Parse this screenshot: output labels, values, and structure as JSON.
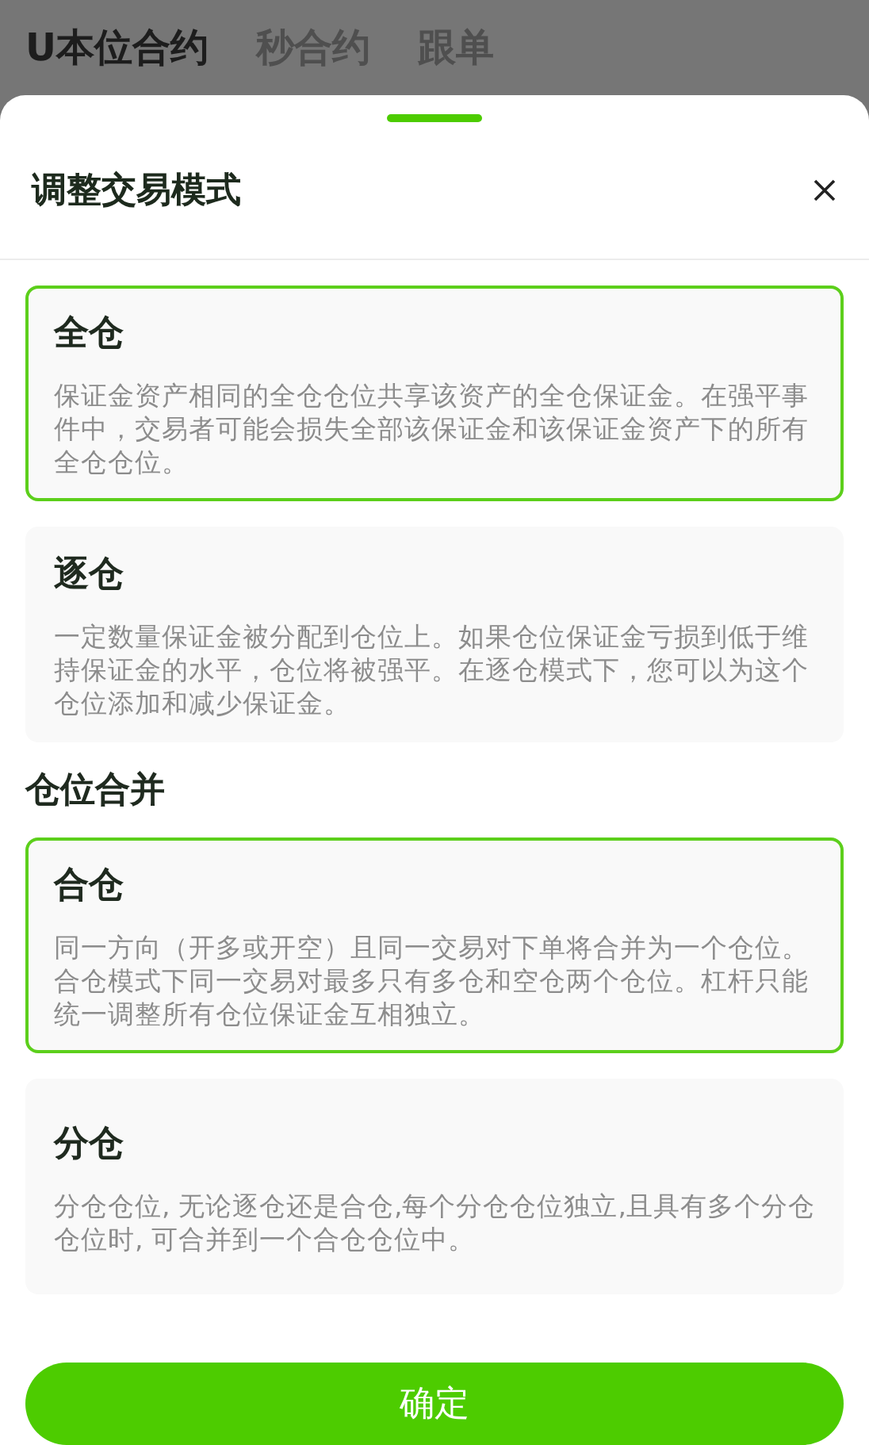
{
  "background_tabs": [
    {
      "label": "U本位合约",
      "selected": true
    },
    {
      "label": "秒合约",
      "selected": false
    },
    {
      "label": "跟单",
      "selected": false
    }
  ],
  "sheet": {
    "title": "调整交易模式",
    "groups": [
      {
        "options": [
          {
            "title": "全仓",
            "description": "保证金资产相同的全仓仓位共享该资产的全仓保证金。在强平事件中，交易者可能会损失全部该保证金和该保证金资产下的所有全仓仓位。",
            "selected": true
          },
          {
            "title": "逐仓",
            "description": "一定数量保证金被分配到仓位上。如果仓位保证金亏损到低于维持保证金的水平，仓位将被强平。在逐仓模式下，您可以为这个仓位添加和减少保证金。",
            "selected": false
          }
        ]
      },
      {
        "heading": "仓位合并",
        "options": [
          {
            "title": "合仓",
            "description": "同一方向（开多或开空）且同一交易对下单将合并为一个仓位。合仓模式下同一交易对最多只有多仓和空仓两个仓位。杠杆只能统一调整所有仓位保证金互相独立。",
            "selected": true
          },
          {
            "title": "分仓",
            "description": "分仓仓位, 无论逐仓还是合仓,每个分仓仓位独立,且具有多个分仓仓位时, 可合并到一个合仓仓位中。",
            "selected": false
          }
        ]
      }
    ],
    "confirm_button": "确定"
  }
}
